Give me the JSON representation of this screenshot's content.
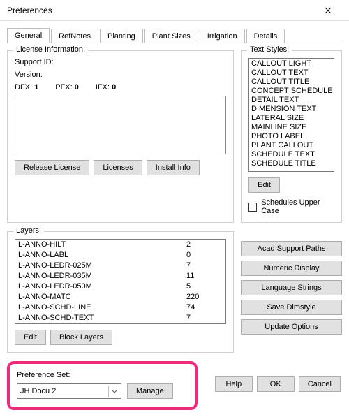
{
  "window": {
    "title": "Preferences"
  },
  "tabs": [
    {
      "label": "General"
    },
    {
      "label": "RefNotes"
    },
    {
      "label": "Planting"
    },
    {
      "label": "Plant Sizes"
    },
    {
      "label": "Irrigation"
    },
    {
      "label": "Details"
    }
  ],
  "license": {
    "legend": "License Information:",
    "support_label": "Support ID:",
    "version_label": "Version:",
    "dfx_label": "DFX:",
    "dfx_value": "1",
    "pfx_label": "PFX:",
    "pfx_value": "0",
    "ifx_label": "IFX:",
    "ifx_value": "0",
    "release_btn": "Release License",
    "licenses_btn": "Licenses",
    "install_btn": "Install Info"
  },
  "textstyles": {
    "legend": "Text Styles:",
    "items": [
      "CALLOUT LIGHT",
      "CALLOUT TEXT",
      "CALLOUT TITLE",
      "CONCEPT SCHEDULE TEXT",
      "DETAIL TEXT",
      "DIMENSION TEXT",
      "LATERAL SIZE",
      "MAINLINE SIZE",
      "PHOTO LABEL",
      "PLANT CALLOUT",
      "SCHEDULE TEXT",
      "SCHEDULE TITLE"
    ],
    "edit_btn": "Edit",
    "upper_label": "Schedules Upper Case"
  },
  "layers": {
    "legend": "Layers:",
    "rows": [
      {
        "name": "L-ANNO-HILT",
        "count": "2"
      },
      {
        "name": "L-ANNO-LABL",
        "count": "0"
      },
      {
        "name": "L-ANNO-LEDR-025M",
        "count": "7"
      },
      {
        "name": "L-ANNO-LEDR-035M",
        "count": "11"
      },
      {
        "name": "L-ANNO-LEDR-050M",
        "count": "5"
      },
      {
        "name": "L-ANNO-MATC",
        "count": "220"
      },
      {
        "name": "L-ANNO-SCHD-LINE",
        "count": "74"
      },
      {
        "name": "L-ANNO-SCHD-TEXT",
        "count": "7"
      }
    ],
    "edit_btn": "Edit",
    "block_btn": "Block Layers"
  },
  "sidebtns": {
    "acad": "Acad Support Paths",
    "numeric": "Numeric Display",
    "lang": "Language Strings",
    "dimstyle": "Save Dimstyle",
    "update": "Update Options"
  },
  "prefset": {
    "legend": "Preference Set:",
    "value": "JH Docu 2",
    "manage_btn": "Manage"
  },
  "footer": {
    "help": "Help",
    "ok": "OK",
    "cancel": "Cancel"
  }
}
